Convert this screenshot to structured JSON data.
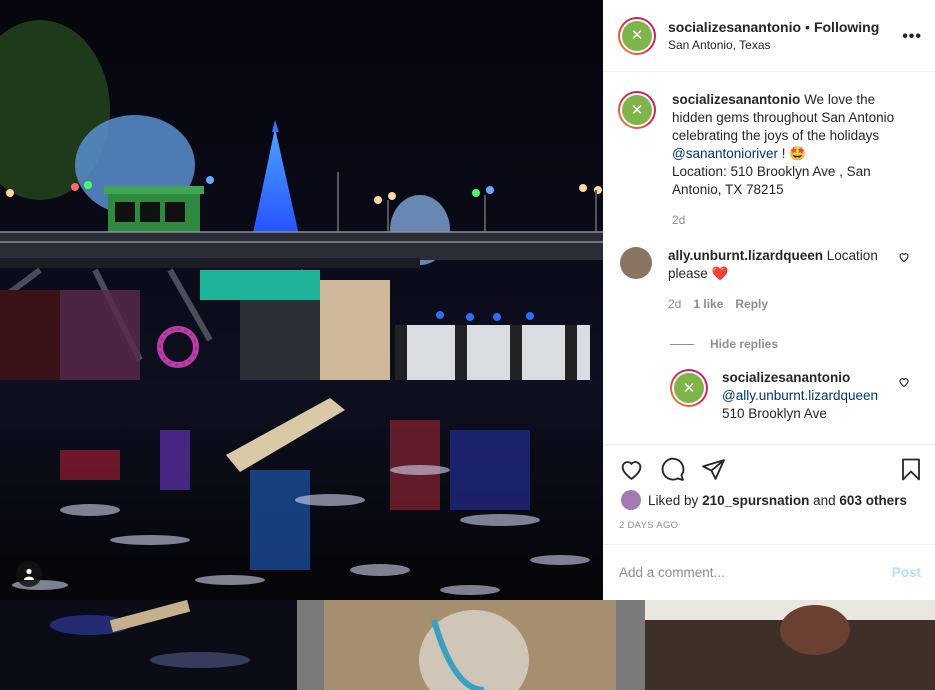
{
  "post": {
    "username": "socializesanantonio",
    "follow_label": "Following",
    "location": "San Antonio, Texas",
    "more_glyph": "•••",
    "caption": {
      "username": "socializesanantonio",
      "text_before": "We love the hidden gems throughout San Antonio celebrating the joys of the holidays",
      "mention": "@sanantonioriver",
      "text_after": "! 🤩",
      "address": "Location: 510 Brooklyn Ave , San Antonio, TX 78215",
      "time": "2d"
    },
    "comments": [
      {
        "username": "ally.unburnt.lizardqueen",
        "text": "Location please ❤️",
        "time": "2d",
        "likes": "1 like",
        "reply_label": "Reply"
      }
    ],
    "hide_replies_label": "Hide replies",
    "reply": {
      "username": "socializesanantonio",
      "mention": "@ally.unburnt.lizardqueen",
      "text": "510 Brooklyn Ave"
    },
    "liked_by_prefix": "Liked by",
    "liked_by_user": "210_spursnation",
    "liked_by_middle": "and",
    "liked_by_others": "603 others",
    "posted_ago": "2 DAYS AGO",
    "comment_placeholder": "Add a comment...",
    "post_button": "Post"
  },
  "icons": {
    "like": "heart-icon",
    "comment": "comment-icon",
    "share": "share-icon",
    "save": "bookmark-icon",
    "tag": "user-tag-icon"
  },
  "colors": {
    "accent_link": "#00376b",
    "muted": "#8e8e8e",
    "post_disabled": "#b2dffc",
    "heart_red": "#ed4956",
    "avatar_green": "#7fb44a"
  }
}
